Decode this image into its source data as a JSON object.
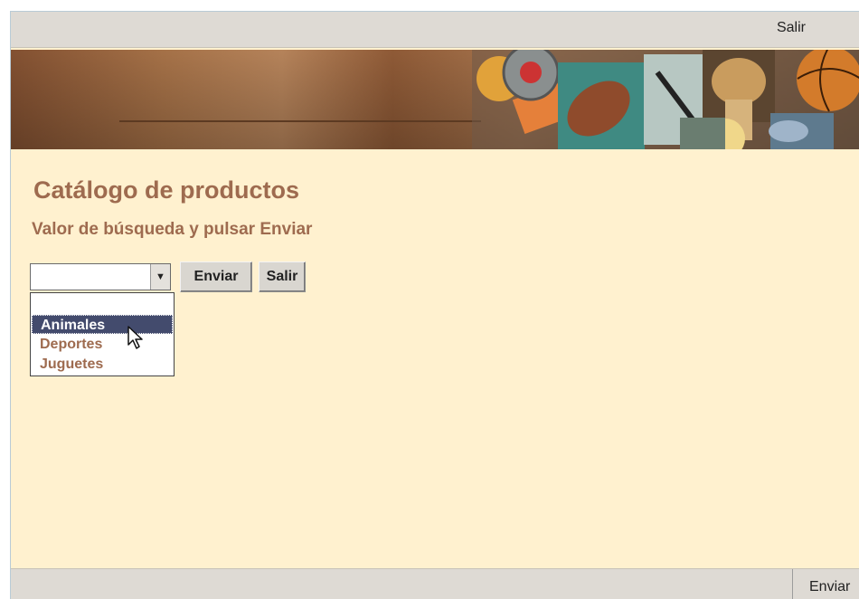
{
  "topbar": {
    "exit_label": "Salir"
  },
  "page": {
    "title": "Catálogo de productos",
    "subtitle": "Valor de búsqueda y pulsar Enviar"
  },
  "form": {
    "select_value": "",
    "submit_label": "Enviar",
    "exit_label": "Salir",
    "options": [
      "Animales",
      "Deportes",
      "Juguetes"
    ],
    "highlighted_option": "Animales"
  },
  "bottombar": {
    "submit_label": "Enviar"
  },
  "icons": {
    "dropdown": "triangle-down-icon",
    "cursor": "mouse-pointer-icon"
  },
  "colors": {
    "accent_text": "#9e6b4f",
    "page_bg": "#fff1cf",
    "selection": "#434b6d"
  }
}
